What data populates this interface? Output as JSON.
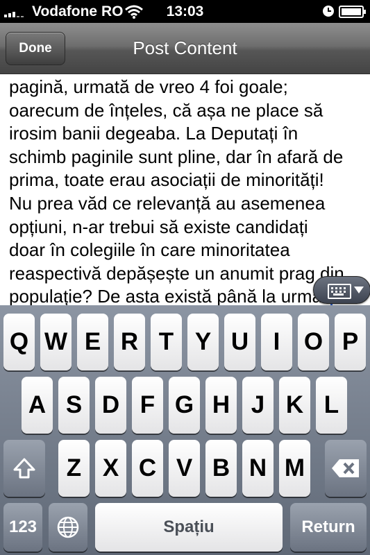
{
  "status_bar": {
    "carrier": "Vodafone RO",
    "time": "13:03",
    "icons": [
      "signal-icon",
      "wifi-icon",
      "clock-icon",
      "battery-icon"
    ]
  },
  "nav": {
    "done_label": "Done",
    "title": "Post Content"
  },
  "content": {
    "lines": [
      "pagină, urmată de vreo 4 foi goale;",
      "oarecum de înțeles, că așa ne place să",
      "irosim banii degeaba. La Deputați în",
      "schimb paginile sunt pline, dar în afară de",
      "prima, toate erau asociații de minorități!",
      "Nu prea văd ce relevanță au asemenea",
      "opțiuni, n-ar trebui să existe candidați",
      "doar în colegiile în care minoritatea",
      "reaspectivă depășește un anumit prag din",
      "populație? De asta există până la urmă"
    ]
  },
  "keyboard": {
    "row1": [
      "Q",
      "W",
      "E",
      "R",
      "T",
      "Y",
      "U",
      "I",
      "O",
      "P"
    ],
    "row2": [
      "A",
      "S",
      "D",
      "F",
      "G",
      "H",
      "J",
      "K",
      "L"
    ],
    "row3": [
      "Z",
      "X",
      "C",
      "V",
      "B",
      "N",
      "M"
    ],
    "numbers_label": "123",
    "space_label": "Spațiu",
    "return_label": "Return",
    "icons": [
      "shift-icon",
      "backspace-icon",
      "globe-icon",
      "keyboard-dismiss-icon"
    ]
  }
}
